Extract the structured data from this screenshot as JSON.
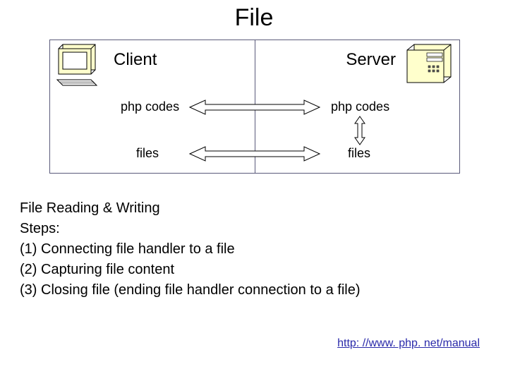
{
  "title": "File",
  "diagram": {
    "client_label": "Client",
    "server_label": "Server",
    "row1_left": "php codes",
    "row1_right": "php codes",
    "row2_left": "files",
    "row2_right": "files"
  },
  "body": {
    "l1": "File Reading & Writing",
    "l2": "Steps:",
    "l3": "(1) Connecting file handler to a file",
    "l4": "(2) Capturing file content",
    "l5": "(3) Closing file (ending file handler connection to a file)"
  },
  "link": "http: //www. php. net/manual"
}
